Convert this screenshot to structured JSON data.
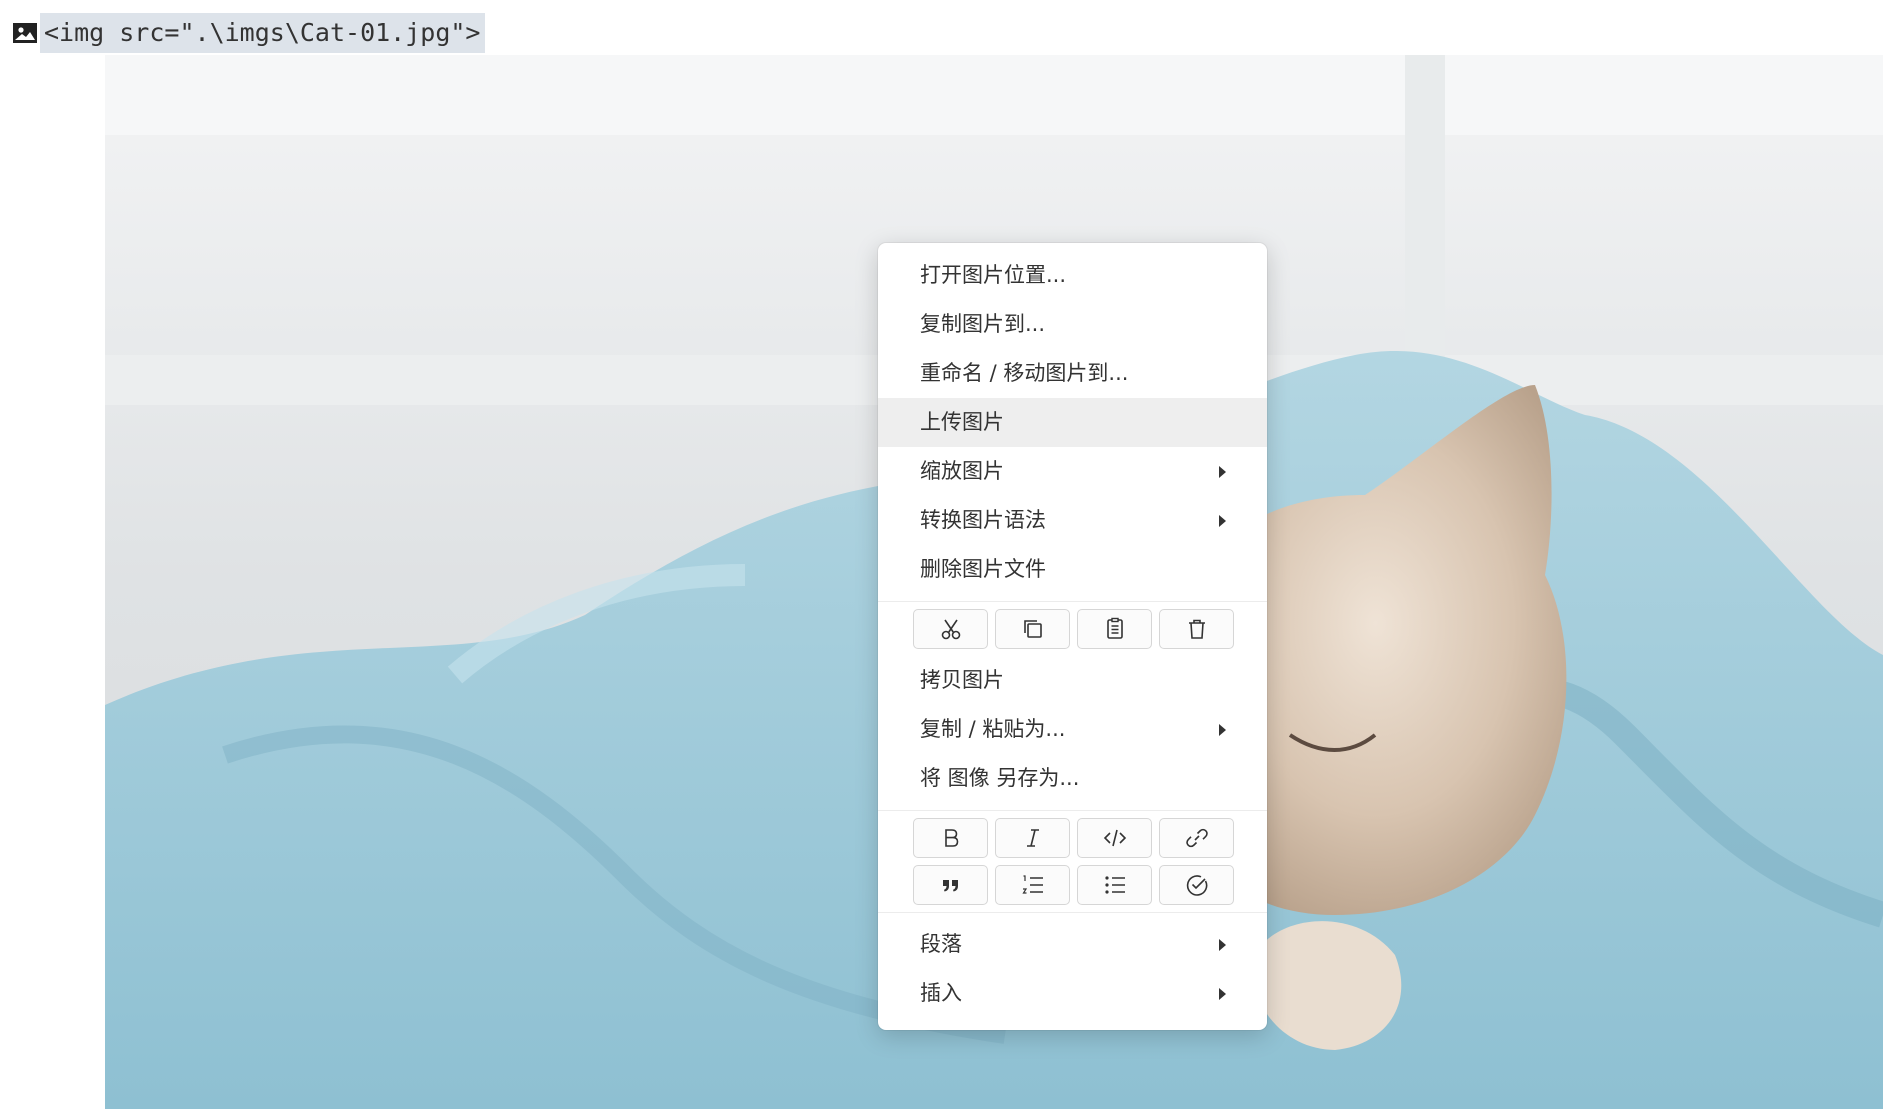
{
  "source_line": {
    "icon": "image-icon",
    "code": "<img src=\".\\imgs\\Cat-01.jpg\">"
  },
  "photo": {
    "subject": "kitten-in-blue-blanket"
  },
  "context_menu": {
    "items_group1": [
      {
        "label": "打开图片位置...",
        "submenu": false
      },
      {
        "label": "复制图片到...",
        "submenu": false
      },
      {
        "label": "重命名 / 移动图片到...",
        "submenu": false
      },
      {
        "label": "上传图片",
        "submenu": false,
        "highlighted": true
      },
      {
        "label": "缩放图片",
        "submenu": true
      },
      {
        "label": "转换图片语法",
        "submenu": true
      },
      {
        "label": "删除图片文件",
        "submenu": false
      }
    ],
    "edit_buttons": [
      "cut-icon",
      "copy-icon",
      "paste-icon",
      "delete-icon"
    ],
    "items_group2": [
      {
        "label": "拷贝图片",
        "submenu": false
      },
      {
        "label": "复制 / 粘贴为...",
        "submenu": true
      },
      {
        "label": "将 图像 另存为...",
        "submenu": false
      }
    ],
    "format_buttons_row1": [
      "bold-icon",
      "italic-icon",
      "code-icon",
      "link-icon"
    ],
    "format_buttons_row2": [
      "quote-icon",
      "ordered-list-icon",
      "unordered-list-icon",
      "task-list-icon"
    ],
    "items_group3": [
      {
        "label": "段落",
        "submenu": true
      },
      {
        "label": "插入",
        "submenu": true
      }
    ]
  },
  "colors": {
    "highlight": "#eeeeee",
    "code_background": "#dde3ea",
    "blanket": "#9dc8d8"
  }
}
